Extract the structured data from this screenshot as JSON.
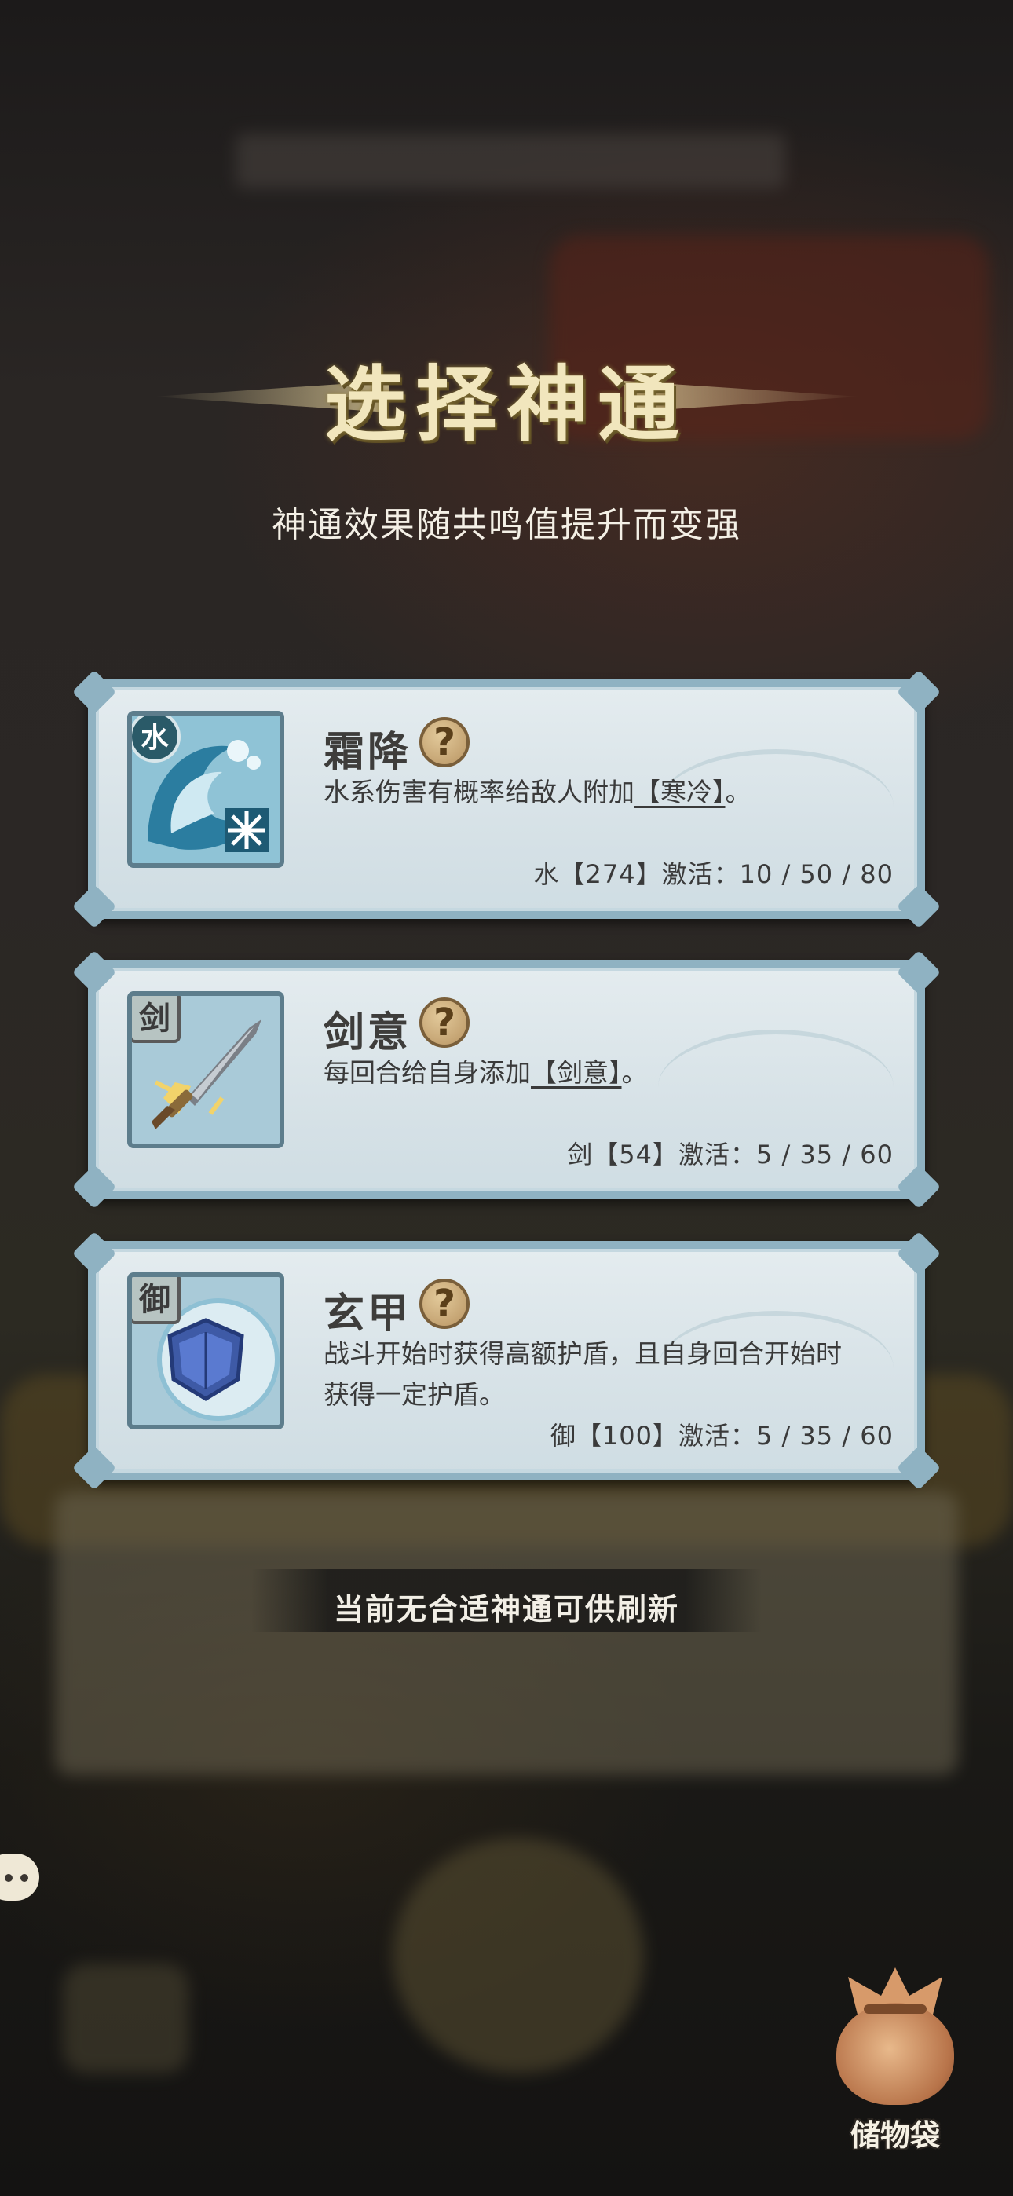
{
  "title": "选择神通",
  "subtitle": "神通效果随共鸣值提升而变强",
  "cards": [
    {
      "element_tag": "水",
      "icon": "water-wave-icon",
      "name": "霜降",
      "help": "?",
      "desc_prefix": "水系伤害有概率给敌人附加",
      "desc_tag": "【寒冷】",
      "desc_suffix": "。",
      "activation": "水【274】激活：10 / 50 / 80"
    },
    {
      "element_tag": "剑",
      "icon": "sword-icon",
      "name": "剑意",
      "help": "?",
      "desc_prefix": "每回合给自身添加",
      "desc_tag": "【剑意】",
      "desc_suffix": "。",
      "activation": "剑【54】激活：5 / 35 / 60"
    },
    {
      "element_tag": "御",
      "icon": "shield-icon",
      "name": "玄甲",
      "help": "?",
      "desc_prefix": "战斗开始时获得高额护盾，且自身回合开始时获得一定护盾。",
      "desc_tag": "",
      "desc_suffix": "",
      "activation": "御【100】激活：5 / 35 / 60"
    }
  ],
  "refresh_text": "当前无合适神通可供刷新",
  "bag_label": "储物袋",
  "colors": {
    "card_border": "#8fb2c2",
    "card_bg": "#e4ecef",
    "title": "#f1e6bd",
    "text_dark": "#3a3a3a"
  }
}
